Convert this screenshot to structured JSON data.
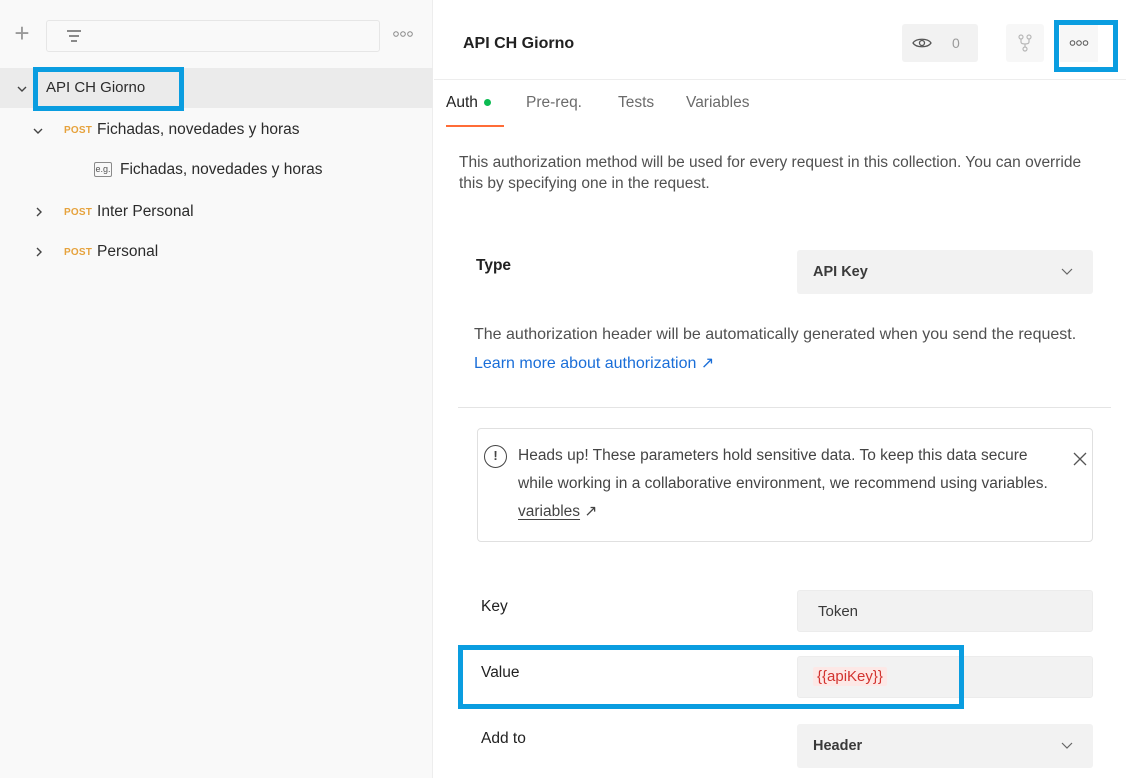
{
  "sidebar": {
    "tree": [
      {
        "label": "API CH Giorno",
        "expanded": true,
        "selected": true
      },
      {
        "method": "POST",
        "label": "Fichadas, novedades y horas",
        "expanded": true
      },
      {
        "badge": "e.g.",
        "label": "Fichadas, novedades y horas"
      },
      {
        "method": "POST",
        "label": "Inter Personal",
        "expanded": false
      },
      {
        "method": "POST",
        "label": "Personal",
        "expanded": false
      }
    ]
  },
  "header": {
    "title": "API CH Giorno",
    "watch_count": "0"
  },
  "tabs": [
    {
      "label": "Auth",
      "active": true,
      "has_indicator": true
    },
    {
      "label": "Pre-req."
    },
    {
      "label": "Tests"
    },
    {
      "label": "Variables"
    }
  ],
  "auth": {
    "description": "This authorization method will be used for every request in this collection. You can override this by specifying one in the request.",
    "type_label": "Type",
    "type_value": "API Key",
    "note_text": "The authorization header will be automatically generated when you send the request.",
    "note_link": "Learn more about authorization ↗",
    "alert_text": "Heads up! These parameters hold sensitive data. To keep this data secure while working in a collaborative environment, we recommend using variables.",
    "alert_link": "variables",
    "alert_link_arrow": "↗",
    "key_label": "Key",
    "key_value": "Token",
    "value_label": "Value",
    "value_value": "{{apiKey}}",
    "add_to_label": "Add to",
    "add_to_value": "Header"
  },
  "colors": {
    "highlight": "#0a9de0",
    "method_post": "#e6a23c",
    "active_tab_underline": "#ff6c37",
    "auth_indicator": "#0cbb52",
    "link": "#1a6ed8",
    "variable": "#d2332f"
  }
}
